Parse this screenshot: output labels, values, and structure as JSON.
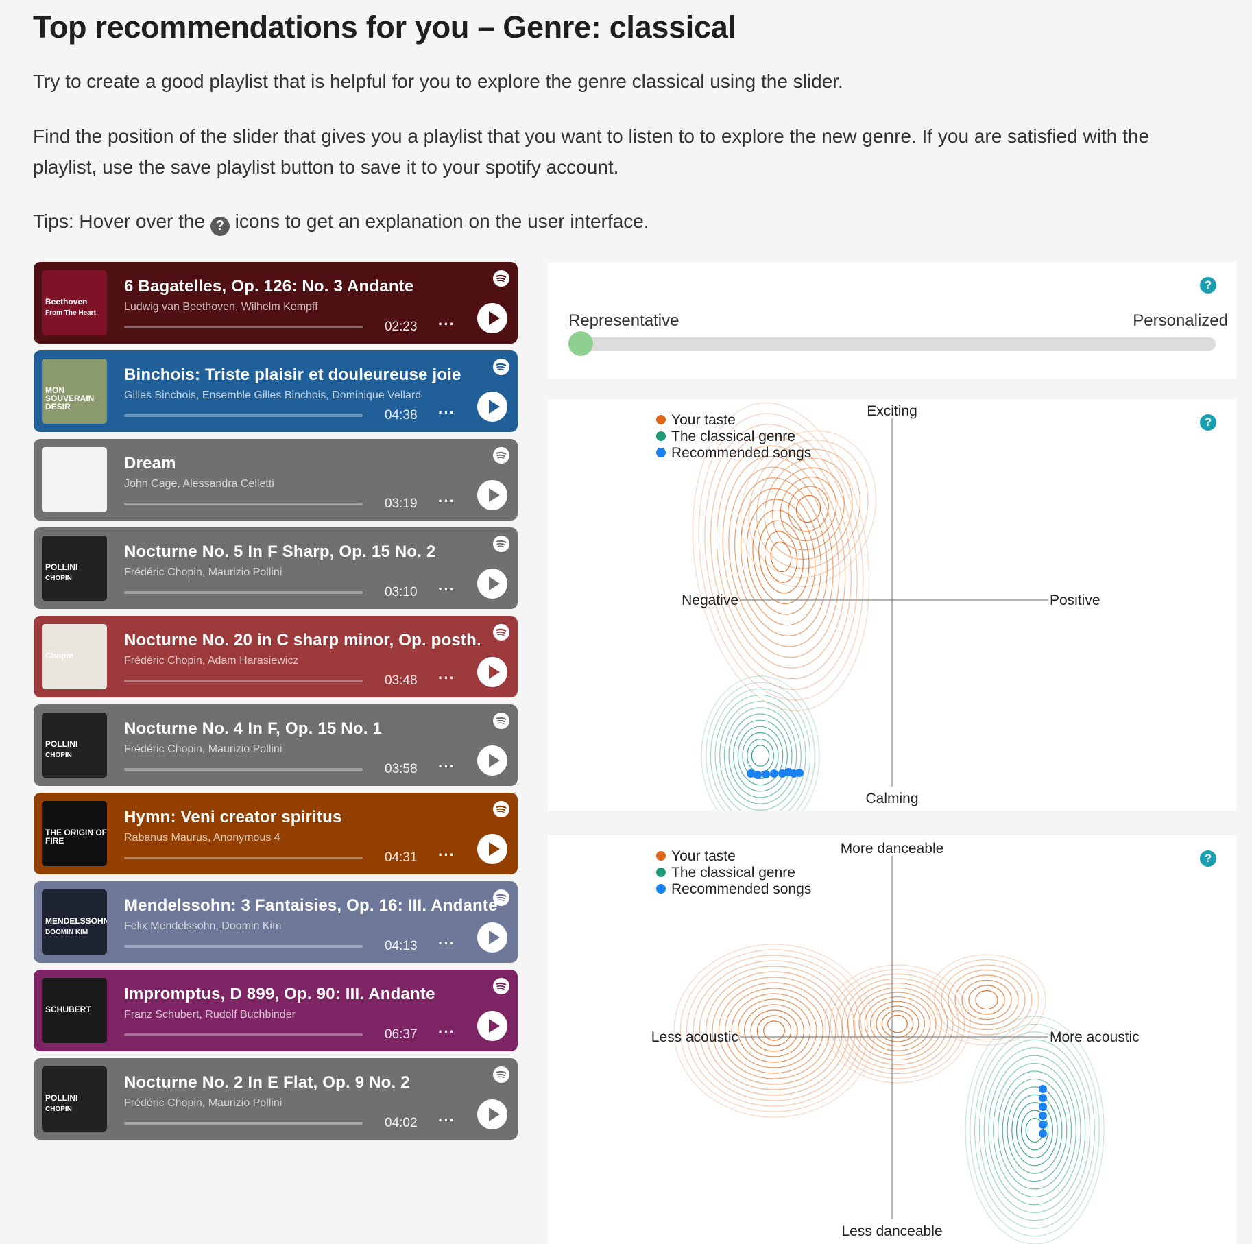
{
  "header": {
    "title": "Top recommendations for you – Genre: classical",
    "intro": "Try to create a good playlist that is helpful for you to explore the genre classical using the slider.",
    "instructions": "Find the position of the slider that gives you a playlist that you want to listen to to explore the new genre. If you are satisfied with the playlist, use the save playlist button to save it to your spotify account.",
    "tips_before": "Tips: Hover over the",
    "tips_icon": "?",
    "tips_after": "icons to get an explanation on the user interface."
  },
  "tracks": [
    {
      "title": "6 Bagatelles, Op. 126: No. 3 Andante",
      "artist": "Ludwig van Beethoven, Wilhelm Kempff",
      "duration": "02:23",
      "color": "#4e1013",
      "cover_text": "Beethoven",
      "cover_sub": "From The Heart",
      "cover_bg": "#7e1226"
    },
    {
      "title": "Binchois: Triste plaisir et douleureuse joie",
      "artist": "Gilles Binchois, Ensemble Gilles Binchois, Dominique Vellard",
      "duration": "04:38",
      "color": "#215f98",
      "cover_text": "MON SOUVERAIN DESIR",
      "cover_sub": "",
      "cover_bg": "#8a9a6c"
    },
    {
      "title": "Dream",
      "artist": "John Cage, Alessandra Celletti",
      "duration": "03:19",
      "color": "#707070",
      "cover_text": "",
      "cover_sub": "",
      "cover_bg": "#f4f4f4"
    },
    {
      "title": "Nocturne No. 5 In F Sharp, Op. 15 No. 2",
      "artist": "Frédéric Chopin, Maurizio Pollini",
      "duration": "03:10",
      "color": "#707070",
      "cover_text": "POLLINI",
      "cover_sub": "CHOPIN",
      "cover_bg": "#222222"
    },
    {
      "title": "Nocturne No. 20 in C sharp minor, Op. posth.",
      "artist": "Frédéric Chopin, Adam Harasiewicz",
      "duration": "03:48",
      "color": "#9c3a3c",
      "cover_text": "Chopin",
      "cover_sub": "",
      "cover_bg": "#eae6df"
    },
    {
      "title": "Nocturne No. 4 In F, Op. 15 No. 1",
      "artist": "Frédéric Chopin, Maurizio Pollini",
      "duration": "03:58",
      "color": "#707070",
      "cover_text": "POLLINI",
      "cover_sub": "CHOPIN",
      "cover_bg": "#222222"
    },
    {
      "title": "Hymn: Veni creator spiritus",
      "artist": "Rabanus Maurus, Anonymous 4",
      "duration": "04:31",
      "color": "#933f00",
      "cover_text": "THE ORIGIN OF FIRE",
      "cover_sub": "",
      "cover_bg": "#111111"
    },
    {
      "title": "Mendelssohn: 3 Fantaisies, Op. 16: III. Andante",
      "artist": "Felix Mendelssohn, Doomin Kim",
      "duration": "04:13",
      "color": "#6e7899",
      "cover_text": "MENDELSSOHN",
      "cover_sub": "DOOMIN KIM",
      "cover_bg": "#1f2433"
    },
    {
      "title": "Impromptus, D 899, Op. 90: III. Andante",
      "artist": "Franz Schubert, Rudolf Buchbinder",
      "duration": "06:37",
      "color": "#7c2464",
      "cover_text": "SCHUBERT",
      "cover_sub": "",
      "cover_bg": "#1a1a1a"
    },
    {
      "title": "Nocturne No. 2 In E Flat, Op. 9 No. 2",
      "artist": "Frédéric Chopin, Maurizio Pollini",
      "duration": "04:02",
      "color": "#707070",
      "cover_text": "POLLINI",
      "cover_sub": "CHOPIN",
      "cover_bg": "#222222"
    }
  ],
  "more_label": "···",
  "slider": {
    "left_label": "Representative",
    "right_label": "Personalized",
    "value": 0.0
  },
  "help_icon": "?",
  "colors": {
    "taste": "#e0661a",
    "genre": "#1c9a7a",
    "recommended": "#1a82f0",
    "help": "#1a9fb0"
  },
  "mood_chart": {
    "legend": [
      "Your taste",
      "The classical genre",
      "Recommended songs"
    ],
    "top": "Exciting",
    "bottom": "Calming",
    "left": "Negative",
    "right": "Positive"
  },
  "dance_chart": {
    "legend": [
      "Your taste",
      "The classical genre",
      "Recommended songs"
    ],
    "top": "More danceable",
    "bottom": "Less danceable",
    "left": "Less acoustic",
    "right": "More acoustic"
  }
}
